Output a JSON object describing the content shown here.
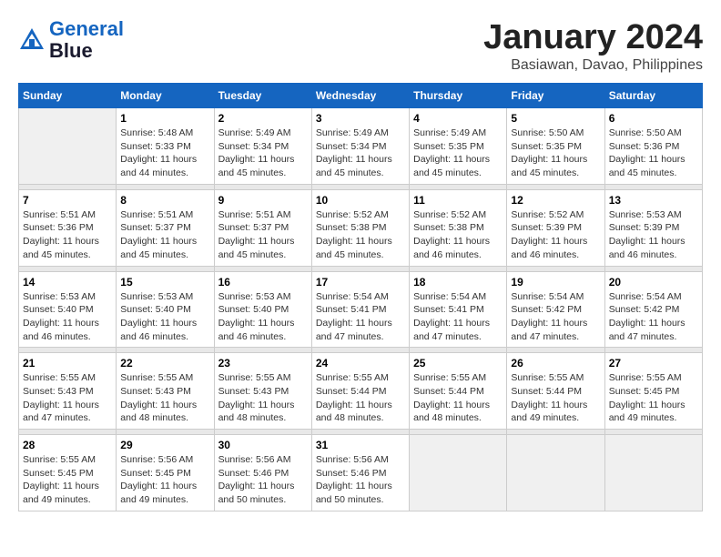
{
  "logo": {
    "line1": "General",
    "line2": "Blue"
  },
  "title": "January 2024",
  "subtitle": "Basiawan, Davao, Philippines",
  "columns": [
    "Sunday",
    "Monday",
    "Tuesday",
    "Wednesday",
    "Thursday",
    "Friday",
    "Saturday"
  ],
  "weeks": [
    {
      "days": [
        {
          "num": "",
          "info": ""
        },
        {
          "num": "1",
          "info": "Sunrise: 5:48 AM\nSunset: 5:33 PM\nDaylight: 11 hours\nand 44 minutes."
        },
        {
          "num": "2",
          "info": "Sunrise: 5:49 AM\nSunset: 5:34 PM\nDaylight: 11 hours\nand 45 minutes."
        },
        {
          "num": "3",
          "info": "Sunrise: 5:49 AM\nSunset: 5:34 PM\nDaylight: 11 hours\nand 45 minutes."
        },
        {
          "num": "4",
          "info": "Sunrise: 5:49 AM\nSunset: 5:35 PM\nDaylight: 11 hours\nand 45 minutes."
        },
        {
          "num": "5",
          "info": "Sunrise: 5:50 AM\nSunset: 5:35 PM\nDaylight: 11 hours\nand 45 minutes."
        },
        {
          "num": "6",
          "info": "Sunrise: 5:50 AM\nSunset: 5:36 PM\nDaylight: 11 hours\nand 45 minutes."
        }
      ]
    },
    {
      "days": [
        {
          "num": "7",
          "info": "Sunrise: 5:51 AM\nSunset: 5:36 PM\nDaylight: 11 hours\nand 45 minutes."
        },
        {
          "num": "8",
          "info": "Sunrise: 5:51 AM\nSunset: 5:37 PM\nDaylight: 11 hours\nand 45 minutes."
        },
        {
          "num": "9",
          "info": "Sunrise: 5:51 AM\nSunset: 5:37 PM\nDaylight: 11 hours\nand 45 minutes."
        },
        {
          "num": "10",
          "info": "Sunrise: 5:52 AM\nSunset: 5:38 PM\nDaylight: 11 hours\nand 45 minutes."
        },
        {
          "num": "11",
          "info": "Sunrise: 5:52 AM\nSunset: 5:38 PM\nDaylight: 11 hours\nand 46 minutes."
        },
        {
          "num": "12",
          "info": "Sunrise: 5:52 AM\nSunset: 5:39 PM\nDaylight: 11 hours\nand 46 minutes."
        },
        {
          "num": "13",
          "info": "Sunrise: 5:53 AM\nSunset: 5:39 PM\nDaylight: 11 hours\nand 46 minutes."
        }
      ]
    },
    {
      "days": [
        {
          "num": "14",
          "info": "Sunrise: 5:53 AM\nSunset: 5:40 PM\nDaylight: 11 hours\nand 46 minutes."
        },
        {
          "num": "15",
          "info": "Sunrise: 5:53 AM\nSunset: 5:40 PM\nDaylight: 11 hours\nand 46 minutes."
        },
        {
          "num": "16",
          "info": "Sunrise: 5:53 AM\nSunset: 5:40 PM\nDaylight: 11 hours\nand 46 minutes."
        },
        {
          "num": "17",
          "info": "Sunrise: 5:54 AM\nSunset: 5:41 PM\nDaylight: 11 hours\nand 47 minutes."
        },
        {
          "num": "18",
          "info": "Sunrise: 5:54 AM\nSunset: 5:41 PM\nDaylight: 11 hours\nand 47 minutes."
        },
        {
          "num": "19",
          "info": "Sunrise: 5:54 AM\nSunset: 5:42 PM\nDaylight: 11 hours\nand 47 minutes."
        },
        {
          "num": "20",
          "info": "Sunrise: 5:54 AM\nSunset: 5:42 PM\nDaylight: 11 hours\nand 47 minutes."
        }
      ]
    },
    {
      "days": [
        {
          "num": "21",
          "info": "Sunrise: 5:55 AM\nSunset: 5:43 PM\nDaylight: 11 hours\nand 47 minutes."
        },
        {
          "num": "22",
          "info": "Sunrise: 5:55 AM\nSunset: 5:43 PM\nDaylight: 11 hours\nand 48 minutes."
        },
        {
          "num": "23",
          "info": "Sunrise: 5:55 AM\nSunset: 5:43 PM\nDaylight: 11 hours\nand 48 minutes."
        },
        {
          "num": "24",
          "info": "Sunrise: 5:55 AM\nSunset: 5:44 PM\nDaylight: 11 hours\nand 48 minutes."
        },
        {
          "num": "25",
          "info": "Sunrise: 5:55 AM\nSunset: 5:44 PM\nDaylight: 11 hours\nand 48 minutes."
        },
        {
          "num": "26",
          "info": "Sunrise: 5:55 AM\nSunset: 5:44 PM\nDaylight: 11 hours\nand 49 minutes."
        },
        {
          "num": "27",
          "info": "Sunrise: 5:55 AM\nSunset: 5:45 PM\nDaylight: 11 hours\nand 49 minutes."
        }
      ]
    },
    {
      "days": [
        {
          "num": "28",
          "info": "Sunrise: 5:55 AM\nSunset: 5:45 PM\nDaylight: 11 hours\nand 49 minutes."
        },
        {
          "num": "29",
          "info": "Sunrise: 5:56 AM\nSunset: 5:45 PM\nDaylight: 11 hours\nand 49 minutes."
        },
        {
          "num": "30",
          "info": "Sunrise: 5:56 AM\nSunset: 5:46 PM\nDaylight: 11 hours\nand 50 minutes."
        },
        {
          "num": "31",
          "info": "Sunrise: 5:56 AM\nSunset: 5:46 PM\nDaylight: 11 hours\nand 50 minutes."
        },
        {
          "num": "",
          "info": ""
        },
        {
          "num": "",
          "info": ""
        },
        {
          "num": "",
          "info": ""
        }
      ]
    }
  ]
}
